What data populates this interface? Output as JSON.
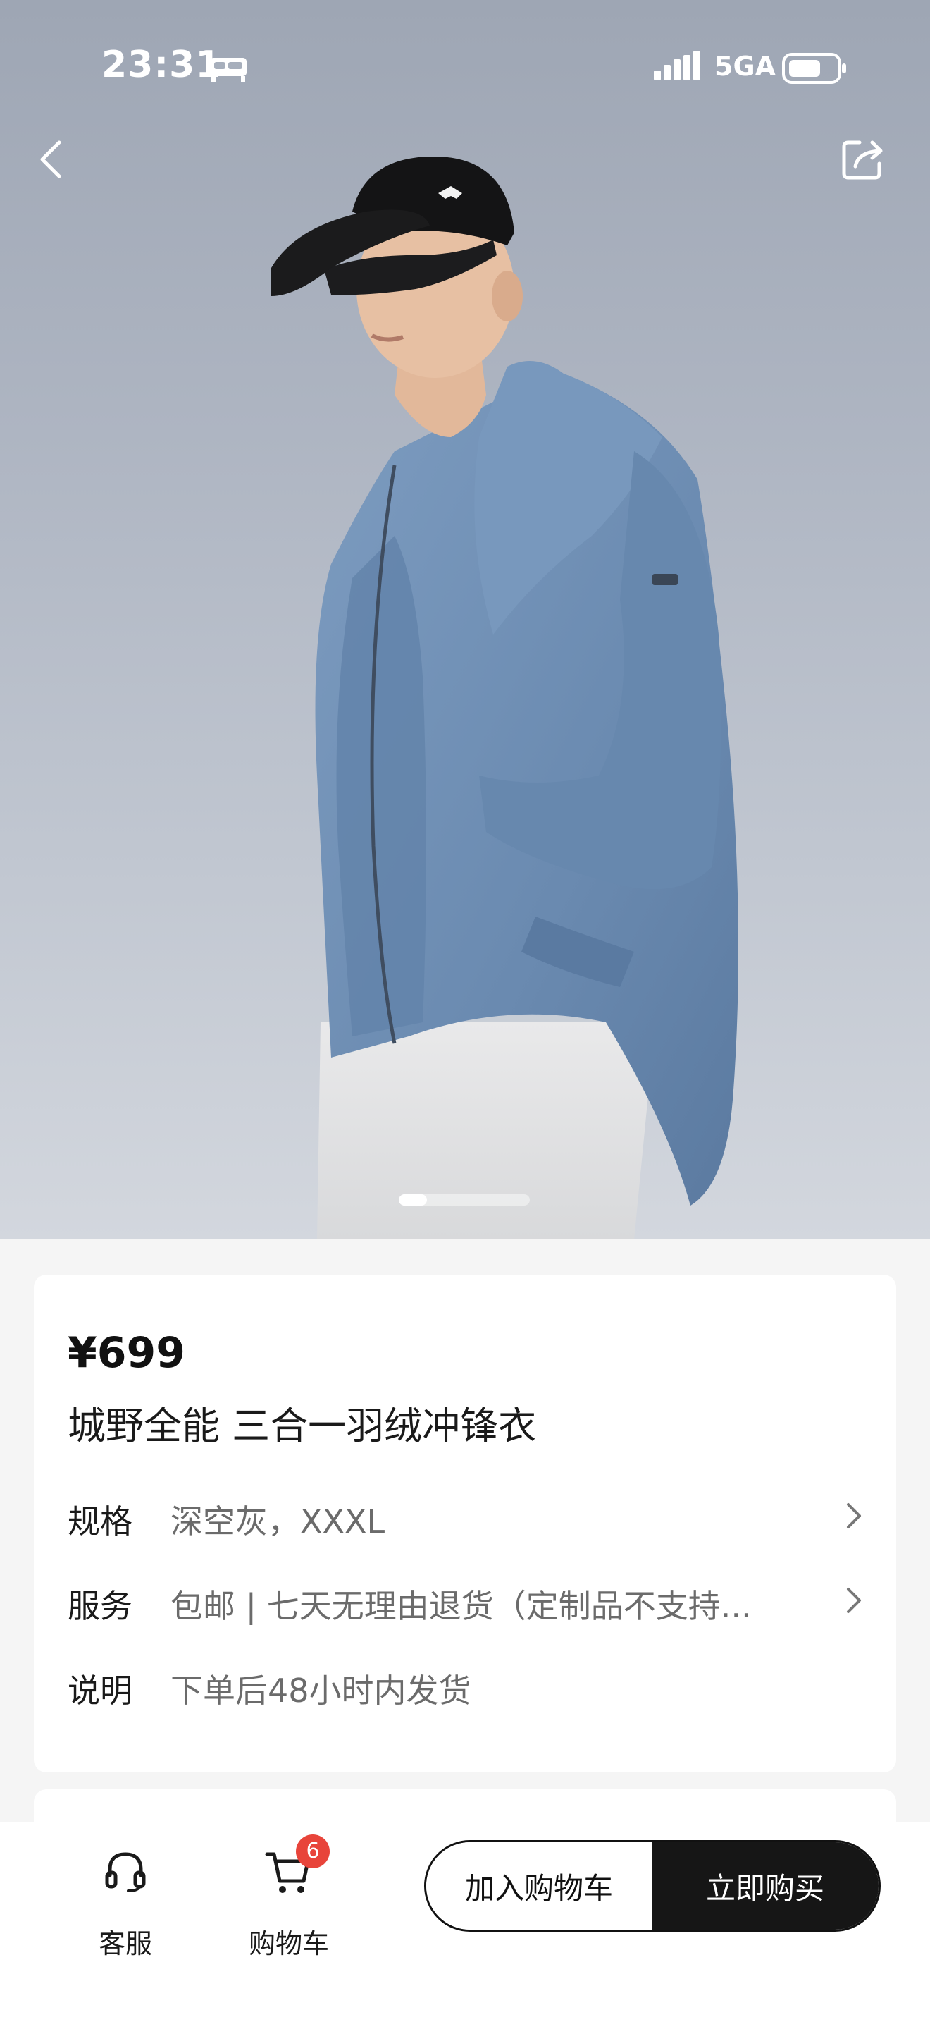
{
  "status_bar": {
    "time": "23:31",
    "network": "5GA",
    "icons": [
      "bed-icon",
      "signal-icon",
      "battery-icon"
    ]
  },
  "nav": {
    "back_icon": "chevron-left-icon",
    "share_icon": "share-icon"
  },
  "gallery": {
    "current_index": 1
  },
  "product": {
    "price": "¥699",
    "title": "城野全能 三合一羽绒冲锋衣",
    "rows": [
      {
        "label": "规格",
        "value": "深空灰，XXXL",
        "has_chevron": true
      },
      {
        "label": "服务",
        "value": "包邮 | 七天无理由退货（定制品不支持...",
        "has_chevron": true
      },
      {
        "label": "说明",
        "value": "下单后48小时内发货",
        "has_chevron": false
      }
    ]
  },
  "bottom_bar": {
    "service_label": "客服",
    "cart_label": "购物车",
    "cart_count": "6",
    "add_to_cart": "加入购物车",
    "buy_now": "立即购买"
  },
  "colors": {
    "primary_button": "#161616",
    "badge": "#e8443a",
    "jacket": "#6f8fb4"
  }
}
